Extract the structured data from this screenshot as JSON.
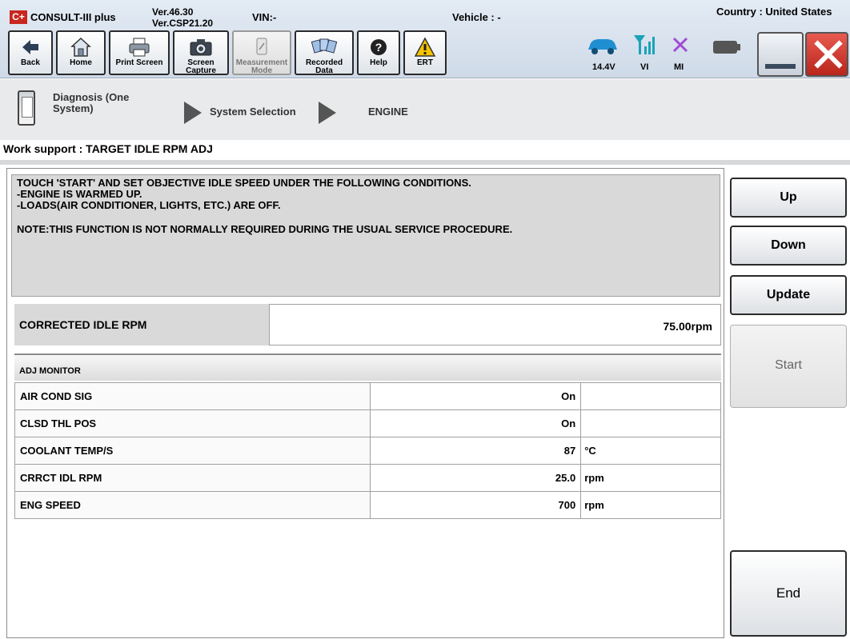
{
  "header": {
    "logo": "C+",
    "app_name": "CONSULT-III plus",
    "version_line1": "Ver.46.30",
    "version_line2": "Ver.CSP21.20",
    "vin": "VIN:-",
    "vehicle": "Vehicle : -",
    "country": "Country : United States"
  },
  "toolbar": {
    "back": "Back",
    "home": "Home",
    "print_screen": "Print Screen",
    "screen_capture": "Screen Capture",
    "measurement_mode": "Measurement Mode",
    "recorded_data": "Recorded Data",
    "help": "Help",
    "ert": "ERT"
  },
  "status": {
    "voltage": "14.4V",
    "vi": "VI",
    "mi": "MI"
  },
  "breadcrumb": {
    "step1": "Diagnosis (One System)",
    "step2": "System Selection",
    "step3": "ENGINE"
  },
  "page_title": "Work support : TARGET IDLE RPM ADJ",
  "instructions": {
    "line1": "TOUCH 'START' AND SET OBJECTIVE IDLE SPEED UNDER THE FOLLOWING CONDITIONS.",
    "line2": "-ENGINE IS WARMED UP.",
    "line3": "-LOADS(AIR CONDITIONER, LIGHTS, ETC.) ARE OFF.",
    "note": "NOTE:THIS FUNCTION IS NOT NORMALLY REQUIRED DURING THE USUAL SERVICE PROCEDURE."
  },
  "corrected": {
    "label": "CORRECTED IDLE RPM",
    "value": "75.00rpm"
  },
  "monitor": {
    "header": "ADJ MONITOR",
    "rows": [
      {
        "name": "AIR COND SIG",
        "value": "On",
        "unit": ""
      },
      {
        "name": "CLSD THL POS",
        "value": "On",
        "unit": ""
      },
      {
        "name": "COOLANT TEMP/S",
        "value": "87",
        "unit": "°C"
      },
      {
        "name": "CRRCT IDL RPM",
        "value": "25.0",
        "unit": "rpm"
      },
      {
        "name": "ENG SPEED",
        "value": "700",
        "unit": "rpm"
      }
    ]
  },
  "actions": {
    "up": "Up",
    "down": "Down",
    "update": "Update",
    "start": "Start",
    "end": "End"
  },
  "colors": {
    "close_red": "#c8261f",
    "ert_yellow": "#f5c400",
    "signal_teal": "#1aa3b8",
    "mi_purple": "#a24ad6",
    "car_blue": "#1f8fd1"
  }
}
